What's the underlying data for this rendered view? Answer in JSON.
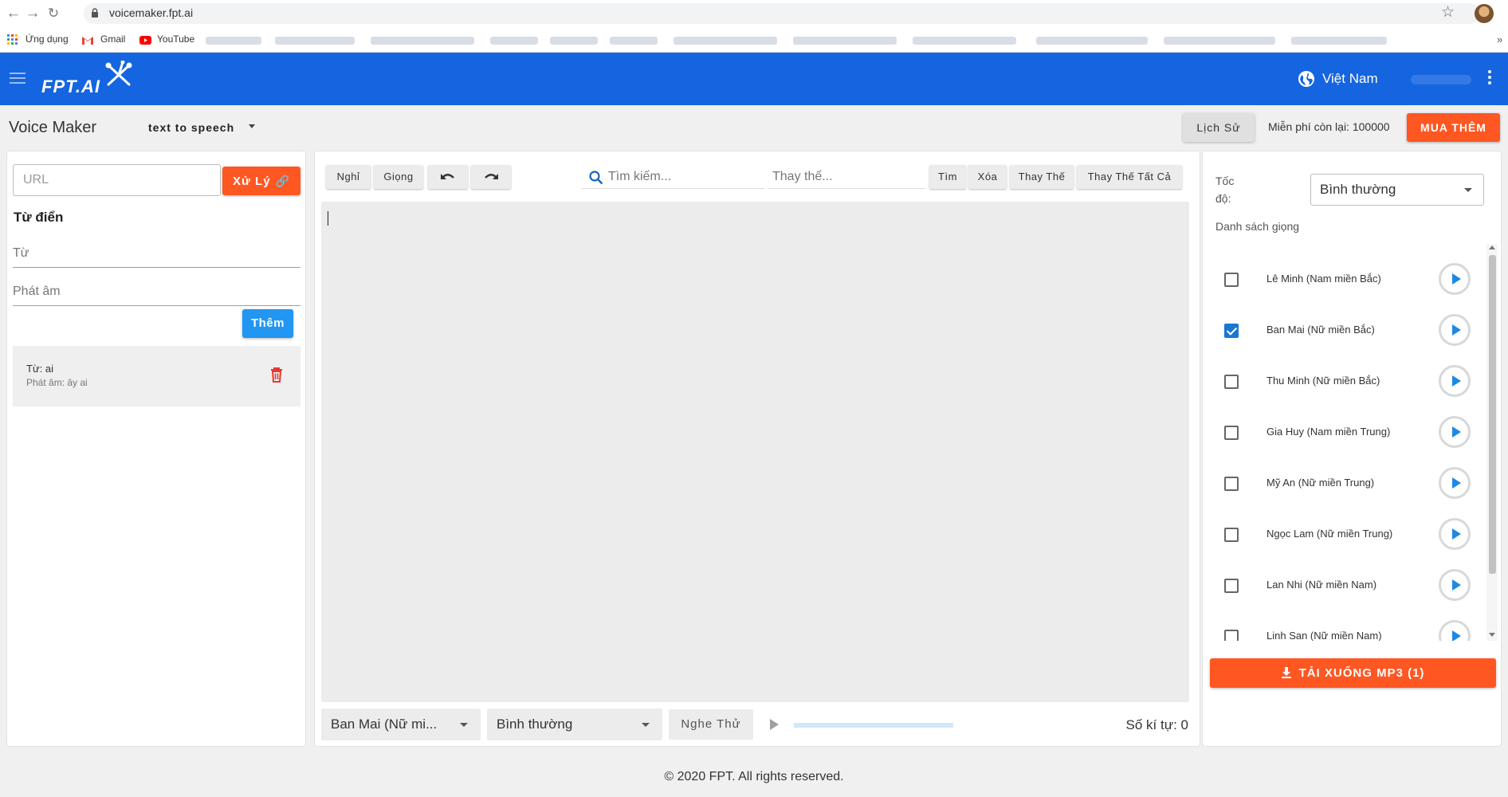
{
  "browser": {
    "url": "voicemaker.fpt.ai",
    "bookmarks": [
      {
        "label": "Ứng dụng",
        "icon": "apps-grid-icon"
      },
      {
        "label": "Gmail",
        "icon": "gmail-icon"
      },
      {
        "label": "YouTube",
        "icon": "youtube-icon"
      }
    ]
  },
  "header": {
    "brand": "FPT.AI",
    "country": "Việt Nam"
  },
  "toolbar": {
    "app_title": "Voice Maker",
    "mode": "text to speech",
    "history_label": "Lịch Sử",
    "free_left": "Miễn phí còn lại: 100000",
    "buy_label": "MUA THÊM"
  },
  "left": {
    "url_placeholder": "URL",
    "process_label": "Xử Lý",
    "dict_title": "Từ điển",
    "word_placeholder": "Từ",
    "pron_placeholder": "Phát âm",
    "add_label": "Thêm",
    "entries": [
      {
        "word": "Từ: ai",
        "pron": "Phát âm: ây ai"
      }
    ]
  },
  "editor": {
    "tools": {
      "pause": "Nghỉ",
      "voice": "Giọng",
      "find": "Tìm",
      "delete": "Xóa",
      "replace": "Thay Thế",
      "replace_all": "Thay Thế Tất Cả"
    },
    "search_placeholder": "Tìm kiếm...",
    "replace_placeholder": "Thay thế...",
    "text": "",
    "voice_select": "Ban Mai (Nữ mi...",
    "speed_select": "Bình thường",
    "listen_label": "Nghe Thử",
    "progress": 0,
    "char_count": "Số kí tự: 0"
  },
  "right": {
    "speed_label": "Tốc độ:",
    "speed_value": "Bình thường",
    "voice_list_title": "Danh sách giọng",
    "voices": [
      {
        "name": "Lê Minh (Nam miền Bắc)",
        "checked": false
      },
      {
        "name": "Ban Mai (Nữ miền Bắc)",
        "checked": true
      },
      {
        "name": "Thu Minh (Nữ miền Bắc)",
        "checked": false
      },
      {
        "name": "Gia Huy (Nam miền Trung)",
        "checked": false
      },
      {
        "name": "Mỹ An (Nữ miền Trung)",
        "checked": false
      },
      {
        "name": "Ngọc Lam (Nữ miền Trung)",
        "checked": false
      },
      {
        "name": "Lan Nhi (Nữ miền Nam)",
        "checked": false
      },
      {
        "name": "Linh San (Nữ miền Nam)",
        "checked": false
      }
    ],
    "download_label": "TẢI XUỐNG MP3 (1)"
  },
  "footer": {
    "copyright": "© 2020 FPT. All rights reserved."
  },
  "colors": {
    "header_blue": "#1565e0",
    "accent_orange": "#ff5722",
    "button_blue": "#2196f3",
    "play_blue": "#1e88e5"
  }
}
